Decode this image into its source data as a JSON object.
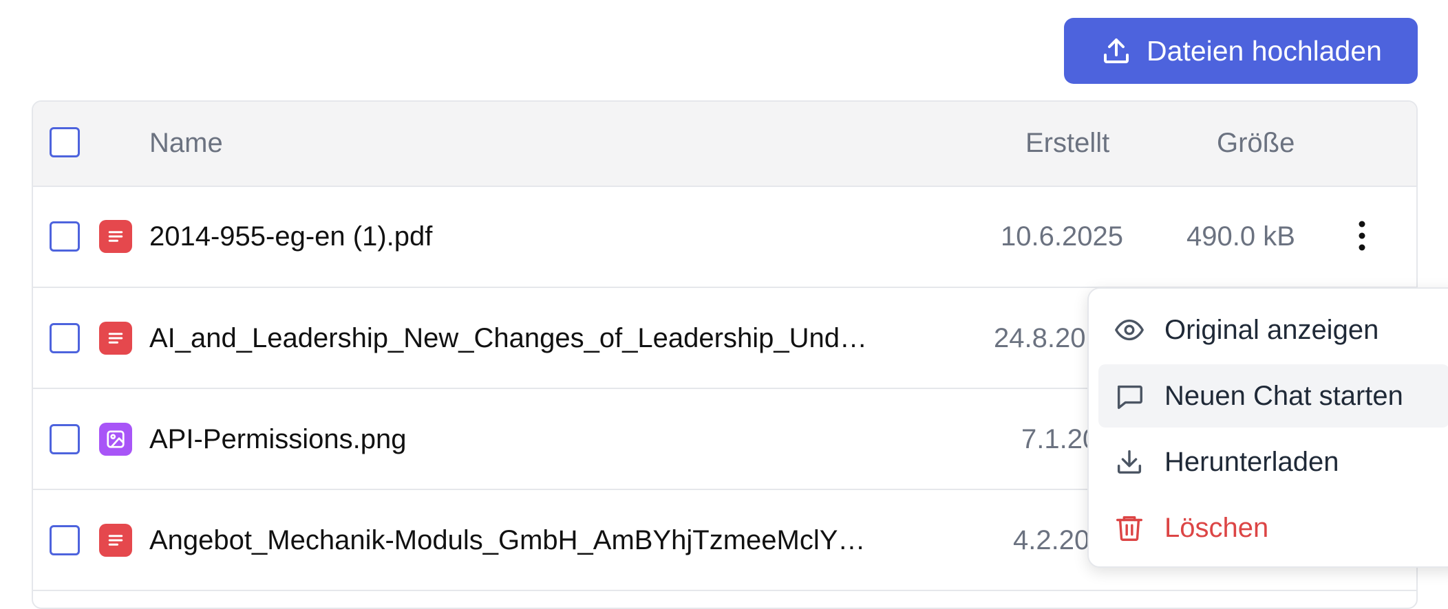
{
  "toolbar": {
    "upload_label": "Dateien hochladen"
  },
  "table": {
    "columns": {
      "name": "Name",
      "created": "Erstellt",
      "size": "Größe"
    },
    "rows": [
      {
        "name": "2014-955-eg-en (1).pdf",
        "created": "10.6.2025",
        "size": "490.0 kB",
        "type": "document-icon"
      },
      {
        "name": "AI_and_Leadership_New_Changes_of_Leadership_Und…",
        "created": "24.8.20",
        "size": "",
        "type": "document-icon"
      },
      {
        "name": "API-Permissions.png",
        "created": "7.1.20",
        "size": "",
        "type": "image-icon"
      },
      {
        "name": "Angebot_Mechanik-Moduls_GmbH_AmBYhjTzmeeMclY…",
        "created": "4.2.20",
        "size": "",
        "type": "document-icon"
      }
    ]
  },
  "context_menu": {
    "items": [
      {
        "label": "Original anzeigen",
        "icon": "eye-icon"
      },
      {
        "label": "Neuen Chat starten",
        "icon": "chat-bubble-icon"
      },
      {
        "label": "Herunterladen",
        "icon": "download-icon"
      },
      {
        "label": "Löschen",
        "icon": "trash-icon"
      }
    ]
  },
  "colors": {
    "primary": "#4d63dd",
    "pdf_red": "#e5484d",
    "image_purple": "#a855f7",
    "danger": "#dc4545",
    "muted_text": "#6b7280"
  }
}
